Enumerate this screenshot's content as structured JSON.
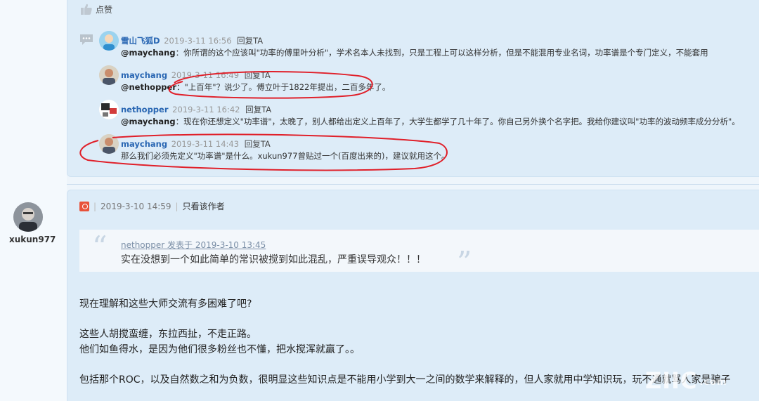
{
  "like": {
    "icon": "thumbs-up-icon",
    "label": "点赞"
  },
  "comments_icon": "comments-icon",
  "replies": [
    {
      "user": "雪山飞狐D",
      "time": "2019-3-11 16:56",
      "action": "回复TA",
      "mention": "@maychang",
      "text": "：你所谓的这个应该叫\"功率的傅里叶分析\"，学术名本人未找到，只是工程上可以这样分析，但是不能混用专业名词，功率谱是个专门定义，不能套用"
    },
    {
      "user": "maychang",
      "time": "2019-3-11 16:49",
      "action": "回复TA",
      "mention": "@nethopper",
      "text": "：\"上百年\"？说少了。傅立叶于1822年提出，二百多年了。"
    },
    {
      "user": "nethopper",
      "time": "2019-3-11 16:42",
      "action": "回复TA",
      "mention": "@maychang",
      "text": "：现在你还想定义\"功率谱\"，太晚了，别人都给出定义上百年了，大学生都学了几十年了。你自己另外换个名字把。我给你建议叫\"功率的波动频率成分分析\"。"
    },
    {
      "user": "maychang",
      "time": "2019-3-11 14:43",
      "action": "回复TA",
      "mention": "",
      "text": "那么我们必须先定义\"功率谱\"是什么。xukun977曾贴过一个(百度出来的)，建议就用这个。"
    }
  ],
  "author": {
    "name": "xukun977"
  },
  "post": {
    "time": "2019-3-10 14:59",
    "only_author": "只看该作者",
    "quote_meta": "nethopper 发表于 2019-3-10 13:45",
    "quote_text": "实在没想到一个如此简单的常识被搅到如此混乱，严重误导观众！！！",
    "lines": [
      "现在理解和这些大师交流有多困难了吧?",
      "这些人胡搅蛮缠，东拉西扯，不走正路。",
      "他们如鱼得水，是因为他们很多粉丝也不懂，把水搅浑就赢了。。",
      "包括那个ROC，以及自然数之和为负数，很明显这些知识点是不能用小学到大一之间的数学来解释的，但人家就用中学知识玩，玩不通就骂人家是骗子"
    ]
  },
  "watermark": {
    "text": "ZIIC",
    "suffix": ".com"
  },
  "colors": {
    "user_link": "#2a67b3",
    "annotation": "#e0202a",
    "panel": "#ddecf8"
  }
}
